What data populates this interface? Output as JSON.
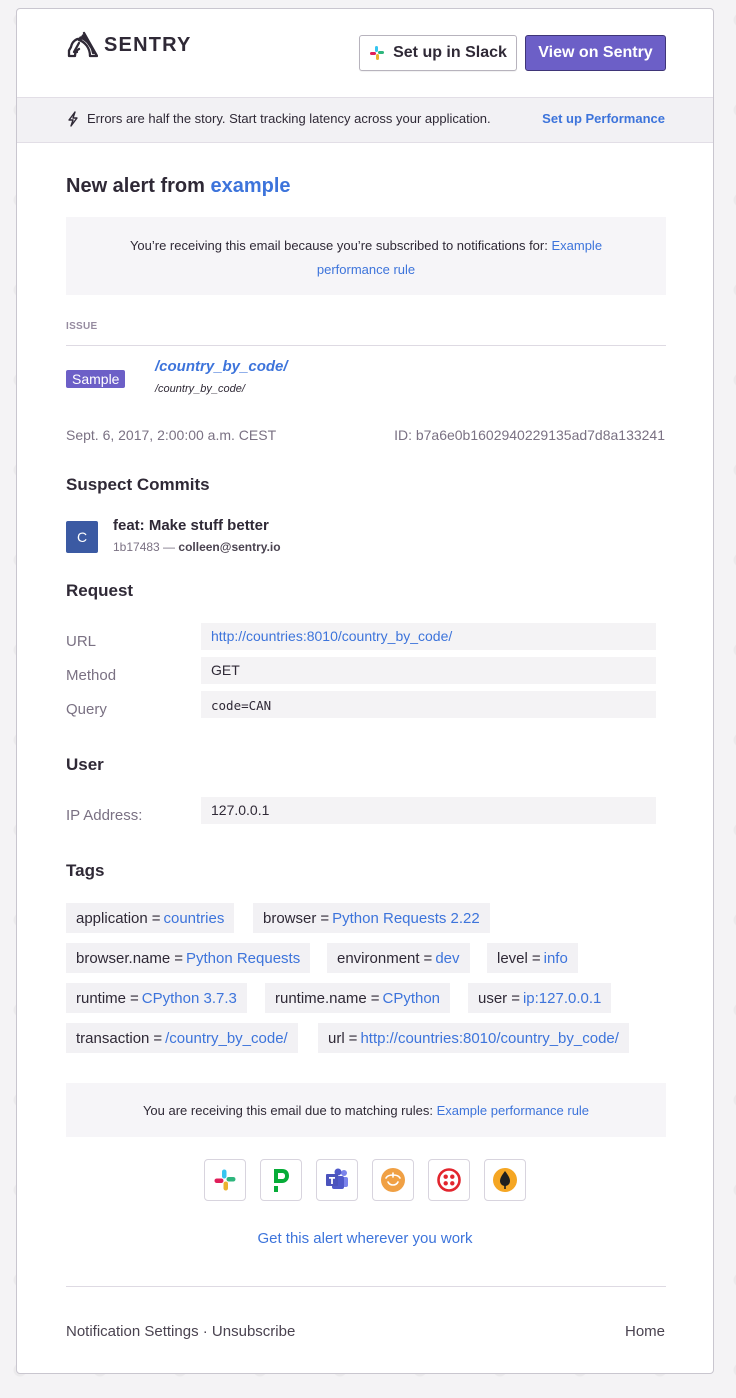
{
  "header": {
    "logo_text": "SENTRY",
    "slack_button": "Set up in Slack",
    "view_button": "View on Sentry"
  },
  "banner": {
    "text": "Errors are half the story. Start tracking latency across your application.",
    "link": "Set up Performance"
  },
  "alert": {
    "title_prefix": "New alert from ",
    "project": "example",
    "notice_text": "You’re receiving this email because you’re subscribed to notifications for: ",
    "notice_link": "Example performance rule"
  },
  "issue": {
    "label": "ISSUE",
    "badge": "Sample",
    "title": "/country_by_code/",
    "subtitle": "/country_by_code/",
    "date": "Sept. 6, 2017, 2:00:00 a.m. CEST",
    "id": "ID: b7a6e0b1602940229135ad7d8a133241"
  },
  "commits": {
    "title": "Suspect Commits",
    "avatar": "C",
    "message": "feat: Make stuff better",
    "hash": "1b17483 —",
    "author": "colleen@sentry.io"
  },
  "request": {
    "title": "Request",
    "url_label": "URL",
    "url_value": "http://countries:8010/country_by_code/",
    "method_label": "Method",
    "method_value": "GET",
    "query_label": "Query",
    "query_value": "code=CAN"
  },
  "user": {
    "title": "User",
    "ip_label": "IP Address:",
    "ip_value": "127.0.0.1"
  },
  "tags": {
    "title": "Tags",
    "items": [
      {
        "key": "application",
        "eq": "=",
        "value": "countries"
      },
      {
        "key": "browser",
        "eq": "=",
        "value": "Python Requests 2.22"
      },
      {
        "key": "browser.name",
        "eq": "=",
        "value": "Python Requests"
      },
      {
        "key": "environment",
        "eq": "=",
        "value": "dev"
      },
      {
        "key": "level",
        "eq": "=",
        "value": "info"
      },
      {
        "key": "runtime",
        "eq": "=",
        "value": "CPython 3.7.3"
      },
      {
        "key": "runtime.name",
        "eq": "=",
        "value": "CPython"
      },
      {
        "key": "user",
        "eq": "=",
        "value": "ip:127.0.0.1"
      },
      {
        "key": "transaction",
        "eq": "=",
        "value": "/country_by_code/"
      },
      {
        "key": "url",
        "eq": "=",
        "value": "http://countries:8010/country_by_code/"
      }
    ]
  },
  "rules": {
    "text": "You are receiving this email due to matching rules: ",
    "link": "Example performance rule"
  },
  "integrations": {
    "icons": [
      "slack-icon",
      "pagerduty-icon",
      "msteams-icon",
      "discord-icon",
      "twilio-icon",
      "opsgenie-icon"
    ],
    "cta": "Get this alert wherever you work"
  },
  "footer": {
    "settings": "Notification Settings",
    "separator": "·",
    "unsubscribe": "Unsubscribe",
    "home": "Home"
  },
  "colors": {
    "accent": "#6c5fc7",
    "link": "#3d74db"
  }
}
